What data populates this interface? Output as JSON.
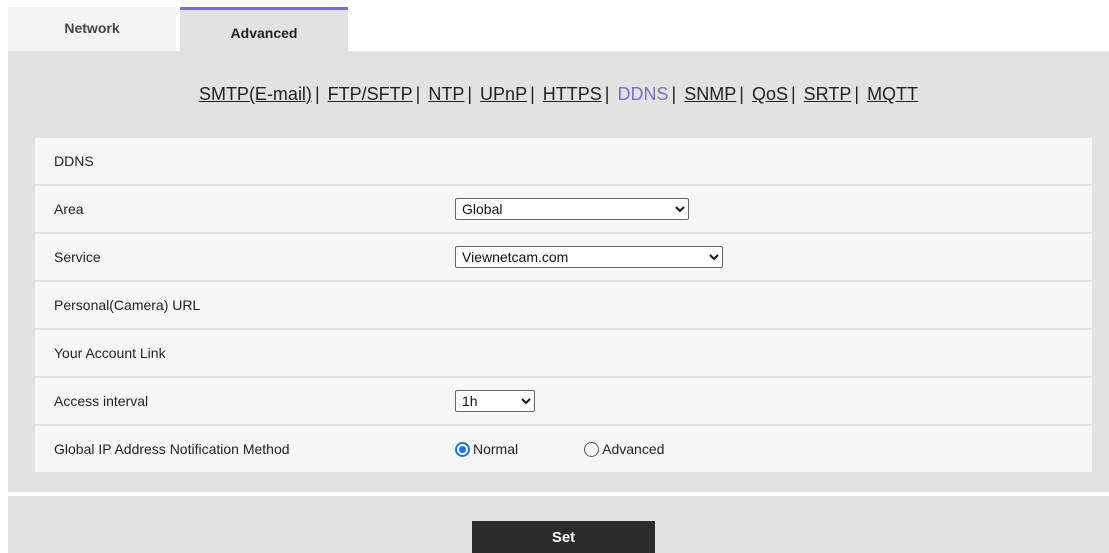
{
  "tabs": [
    {
      "label": "Network"
    },
    {
      "label": "Advanced"
    }
  ],
  "submenu": [
    {
      "label": "SMTP(E-mail)"
    },
    {
      "label": "FTP/SFTP"
    },
    {
      "label": "NTP"
    },
    {
      "label": "UPnP"
    },
    {
      "label": "HTTPS"
    },
    {
      "label": "DDNS"
    },
    {
      "label": "SNMP"
    },
    {
      "label": "QoS"
    },
    {
      "label": "SRTP"
    },
    {
      "label": "MQTT"
    }
  ],
  "separator": "|",
  "section_title": "DDNS",
  "fields": {
    "area": {
      "label": "Area",
      "value": "Global"
    },
    "service": {
      "label": "Service",
      "value": "Viewnetcam.com"
    },
    "personal_url": {
      "label": "Personal(Camera) URL"
    },
    "account_link": {
      "label": "Your Account Link"
    },
    "access_interval": {
      "label": "Access interval",
      "value": "1h"
    },
    "notification": {
      "label": "Global IP Address Notification Method",
      "options": [
        {
          "label": "Normal",
          "selected": true
        },
        {
          "label": "Advanced",
          "selected": false
        }
      ]
    }
  },
  "set_button": "Set",
  "colors": {
    "accent": "#7a6fc6",
    "panel": "#e2e2e2",
    "radio": "#1a73e8"
  }
}
